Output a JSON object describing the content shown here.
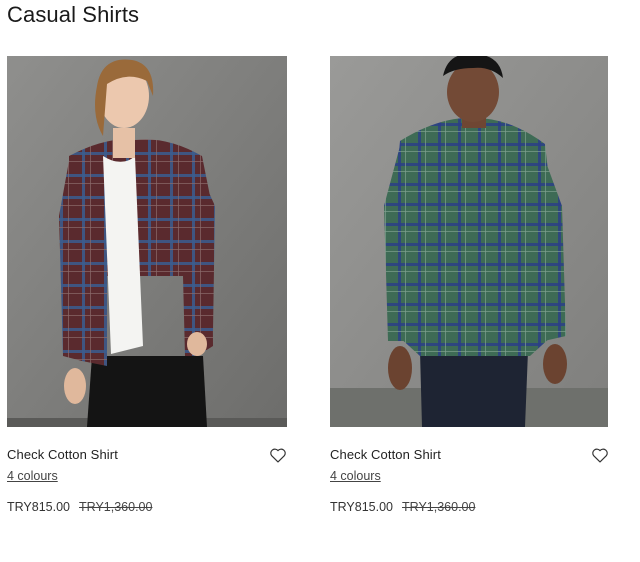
{
  "page": {
    "title": "Casual Shirts"
  },
  "products": [
    {
      "name": "Check Cotton Shirt",
      "colours": "4 colours",
      "price": "TRY815.00",
      "was_price": "TRY1,360.00",
      "shirt_color": "#5a2a2e",
      "check_color": "#3b5d8f"
    },
    {
      "name": "Check Cotton Shirt",
      "colours": "4 colours",
      "price": "TRY815.00",
      "was_price": "TRY1,360.00",
      "shirt_color": "#3e6b55",
      "check_color": "#2c3f86"
    }
  ],
  "icons": {
    "wishlist": "heart-outline-icon"
  }
}
